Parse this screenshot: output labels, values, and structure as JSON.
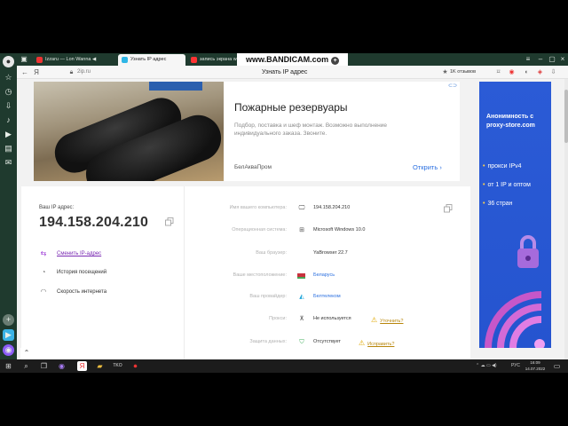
{
  "colors": {
    "sidebar_bg": "#1f3a2e",
    "accent_purple": "#7a2ab3",
    "link_blue": "#2a6fe0",
    "banner_blue": "#2554cf",
    "warning": "#e0a800"
  },
  "sidebar": {
    "icons": [
      "avatar-icon",
      "bookmark-icon",
      "history-icon",
      "download-icon",
      "music-icon",
      "video-icon",
      "notes-icon",
      "messenger-icon",
      "add-icon",
      "alice-icon"
    ]
  },
  "tabs": [
    {
      "label": "Izzaru — Lon Wanna ◀",
      "icon": "video-icon",
      "active": false
    },
    {
      "label": "Узнать IP адрес",
      "icon": "2ip-icon",
      "active": true
    },
    {
      "label": "запись экрана win",
      "icon": "yandex-icon",
      "active": false
    }
  ],
  "bandicam": {
    "text": "www.BANDICAM.com",
    "plus": "+"
  },
  "address": {
    "domain": "2ip.ru",
    "page_title": "Узнать IP адрес",
    "reviews": "1K отзывов"
  },
  "ad": {
    "title": "Пожарные резервуары",
    "description": "Подбор, поставка и шеф монтаж. Возможно выполнение индивидуального заказа. Звоните.",
    "brand": "БелАкваПром",
    "open_label": "Открить ›"
  },
  "banner": {
    "title": "Анонимность с proxy-store.com",
    "features": [
      "прокси IPv4",
      "от 1 IP и оптом",
      "36 стран"
    ],
    "bullet": "•"
  },
  "ipcard": {
    "ip_label": "Ваш IP адрес:",
    "ip_value": "194.158.204.210",
    "actions": [
      {
        "label": "Сменить IP-адрес",
        "icon": "swap-icon",
        "link": true
      },
      {
        "label": "История посещений",
        "icon": "history-icon",
        "link": false
      },
      {
        "label": "Скорость интернета",
        "icon": "speed-icon",
        "link": false
      }
    ],
    "details": [
      {
        "key": "Имя вашего компьютера:",
        "icon": "monitor-icon",
        "value": "194.158.204.210",
        "link": false
      },
      {
        "key": "Операционная система:",
        "icon": "windows-icon",
        "value": "Microsoft Windows 10.0",
        "link": false
      },
      {
        "key": "Ваш браузер:",
        "icon": "",
        "value": "YaBrowser 22.7",
        "link": false
      },
      {
        "key": "Ваше местоположение:",
        "icon": "flag-icon",
        "value": "Беларусь",
        "link": true
      },
      {
        "key": "Ваш провайдер:",
        "icon": "provider-icon",
        "value": "Белтелеком",
        "link": true
      },
      {
        "key": "Прокси:",
        "icon": "network-icon",
        "value": "Не используется",
        "link": false,
        "warn": "Уточнить?"
      },
      {
        "key": "Защита данных:",
        "icon": "shield-icon",
        "value": "Отсутствует",
        "link": false,
        "warn": "Исправить?"
      }
    ]
  },
  "taskbar": {
    "language": "РУС",
    "time": "16:09",
    "date": "14.07.2022",
    "app_badge": "TKO"
  }
}
